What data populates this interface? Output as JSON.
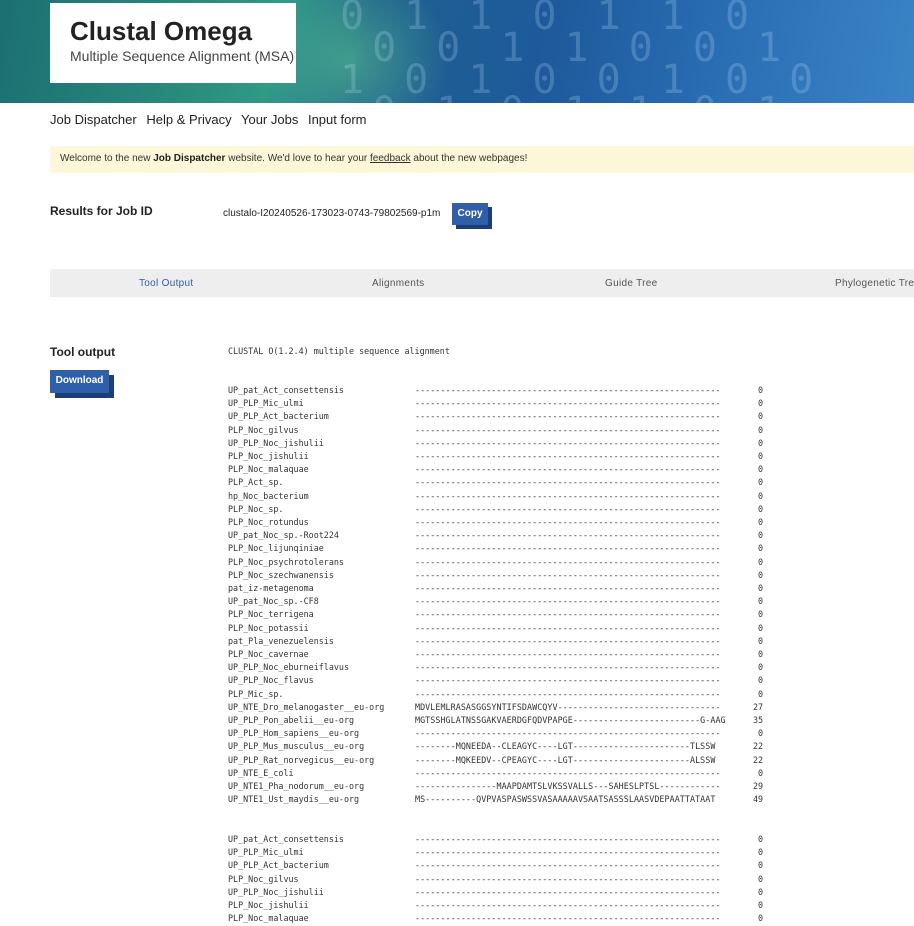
{
  "header": {
    "title": "Clustal Omega",
    "subtitle": "Multiple Sequence Alignment (MSA)"
  },
  "nav": [
    "Job Dispatcher",
    "Help & Privacy",
    "Your Jobs",
    "Input form"
  ],
  "notice": {
    "prefix": "Welcome to the new ",
    "bold": "Job Dispatcher",
    "middle": " website. We'd love to hear your ",
    "link": "feedback",
    "suffix": " about the new webpages!"
  },
  "job": {
    "label": "Results for Job ID",
    "id": "clustalo-I20240526-173023-0743-79802569-p1m",
    "copy_label": "Copy"
  },
  "tabs": [
    "Tool Output",
    "Alignments",
    "Guide Tree",
    "Phylogenetic Tree"
  ],
  "tool_output": {
    "label": "Tool output",
    "download_label": "Download",
    "header": "CLUSTAL O(1.2.4) multiple sequence alignment",
    "block1": [
      {
        "name": "UP_pat_Act_consettensis",
        "seq": "------------------------------------------------------------",
        "count": "0"
      },
      {
        "name": "UP_PLP_Mic_ulmi",
        "seq": "------------------------------------------------------------",
        "count": "0"
      },
      {
        "name": "UP_PLP_Act_bacterium",
        "seq": "------------------------------------------------------------",
        "count": "0"
      },
      {
        "name": "PLP_Noc_gilvus",
        "seq": "------------------------------------------------------------",
        "count": "0"
      },
      {
        "name": "UP_PLP_Noc_jishulii",
        "seq": "------------------------------------------------------------",
        "count": "0"
      },
      {
        "name": "PLP_Noc_jishulii",
        "seq": "------------------------------------------------------------",
        "count": "0"
      },
      {
        "name": "PLP_Noc_malaquae",
        "seq": "------------------------------------------------------------",
        "count": "0"
      },
      {
        "name": "PLP_Act_sp.",
        "seq": "------------------------------------------------------------",
        "count": "0"
      },
      {
        "name": "hp_Noc_bacterium",
        "seq": "------------------------------------------------------------",
        "count": "0"
      },
      {
        "name": "PLP_Noc_sp.",
        "seq": "------------------------------------------------------------",
        "count": "0"
      },
      {
        "name": "PLP_Noc_rotundus",
        "seq": "------------------------------------------------------------",
        "count": "0"
      },
      {
        "name": "UP_pat_Noc_sp.-Root224",
        "seq": "------------------------------------------------------------",
        "count": "0"
      },
      {
        "name": "PLP_Noc_lijunqiniae",
        "seq": "------------------------------------------------------------",
        "count": "0"
      },
      {
        "name": "PLP_Noc_psychrotolerans",
        "seq": "------------------------------------------------------------",
        "count": "0"
      },
      {
        "name": "PLP_Noc_szechwanensis",
        "seq": "------------------------------------------------------------",
        "count": "0"
      },
      {
        "name": "pat_iz-metagenoma",
        "seq": "------------------------------------------------------------",
        "count": "0"
      },
      {
        "name": "UP_pat_Noc_sp.-CF8",
        "seq": "------------------------------------------------------------",
        "count": "0"
      },
      {
        "name": "PLP_Noc_terrigena",
        "seq": "------------------------------------------------------------",
        "count": "0"
      },
      {
        "name": "PLP_Noc_potassii",
        "seq": "------------------------------------------------------------",
        "count": "0"
      },
      {
        "name": "pat_Pla_venezuelensis",
        "seq": "------------------------------------------------------------",
        "count": "0"
      },
      {
        "name": "PLP_Noc_cavernae",
        "seq": "------------------------------------------------------------",
        "count": "0"
      },
      {
        "name": "UP_PLP_Noc_eburneiflavus",
        "seq": "------------------------------------------------------------",
        "count": "0"
      },
      {
        "name": "UP_PLP_Noc_flavus",
        "seq": "------------------------------------------------------------",
        "count": "0"
      },
      {
        "name": "PLP_Mic_sp.",
        "seq": "------------------------------------------------------------",
        "count": "0"
      },
      {
        "name": "UP_NTE_Dro_melanogaster__eu-org",
        "seq": "MDVLEMLRASASGGSYNTIFSDAWCQYV--------------------------------",
        "count": "27"
      },
      {
        "name": "UP_PLP_Pon_abelii__eu-org",
        "seq": "MGTSSHGLATNSSGAKVAERDGFQDVPAPGE-------------------------G-AAG",
        "count": "35"
      },
      {
        "name": "UP_PLP_Hom_sapiens__eu-org",
        "seq": "------------------------------------------------------------",
        "count": "0"
      },
      {
        "name": "UP_PLP_Mus_musculus__eu-org",
        "seq": "--------MQNEEDA--CLEAGYC----LGT-----------------------TLSSW",
        "count": "22"
      },
      {
        "name": "UP_PLP_Rat_norvegicus__eu-org",
        "seq": "--------MQKEEDV--CPEAGYC----LGT-----------------------ALSSW",
        "count": "22"
      },
      {
        "name": "UP_NTE_E_coli",
        "seq": "------------------------------------------------------------",
        "count": "0"
      },
      {
        "name": "UP_NTE1_Pha_nodorum__eu-org",
        "seq": "----------------MAAPDAMTSLVKSSVALLS---SAHESLPTSL------------",
        "count": "29"
      },
      {
        "name": "UP_NTE1_Ust_maydis__eu-org",
        "seq": "MS----------QVPVASPASWSSVASAAAAAVSAATSASSSLAASVDEPAATTATAAT",
        "count": "49"
      }
    ],
    "block2": [
      {
        "name": "UP_pat_Act_consettensis",
        "seq": "------------------------------------------------------------",
        "count": "0"
      },
      {
        "name": "UP_PLP_Mic_ulmi",
        "seq": "------------------------------------------------------------",
        "count": "0"
      },
      {
        "name": "UP_PLP_Act_bacterium",
        "seq": "------------------------------------------------------------",
        "count": "0"
      },
      {
        "name": "PLP_Noc_gilvus",
        "seq": "------------------------------------------------------------",
        "count": "0"
      },
      {
        "name": "UP_PLP_Noc_jishulii",
        "seq": "------------------------------------------------------------",
        "count": "0"
      },
      {
        "name": "PLP_Noc_jishulii",
        "seq": "------------------------------------------------------------",
        "count": "0"
      },
      {
        "name": "PLP_Noc_malaquae",
        "seq": "------------------------------------------------------------",
        "count": "0"
      }
    ]
  },
  "colors": {
    "accent": "#2f5fa8",
    "notice_bg": "#fbf7d8",
    "tabs_bg": "#eeeeee"
  }
}
